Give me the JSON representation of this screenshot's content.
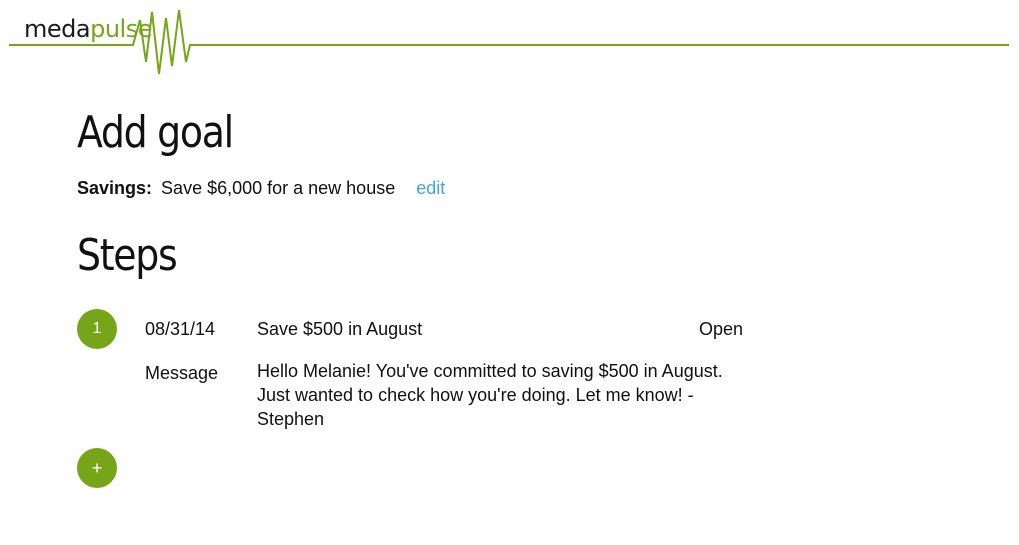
{
  "brand": {
    "name_part1": "meda",
    "name_part2": "pulse",
    "accent_color": "#77a51a",
    "link_color": "#3ea6d8"
  },
  "page": {
    "title": "Add goal"
  },
  "goal": {
    "label": "Savings:",
    "text": "Save $6,000 for a new house",
    "edit_label": "edit"
  },
  "steps_section": {
    "title": "Steps",
    "steps": [
      {
        "number": "1",
        "date": "08/31/14",
        "title": "Save $500 in August",
        "status": "Open",
        "message_label": "Message",
        "message": "Hello Melanie! You've committed to saving $500 in August. Just wanted to check how you're doing. Let me know! - Stephen"
      }
    ],
    "add_icon": "plus-icon",
    "add_label": "+"
  }
}
